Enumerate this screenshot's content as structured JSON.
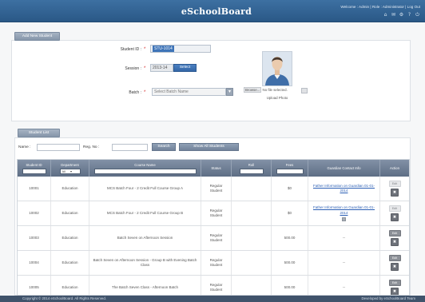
{
  "header": {
    "title": "eSchoolBoard",
    "user_info": "Welcome : Admin  |  Role : Administrator  |  Log Out",
    "icons": [
      "home-icon",
      "mail-icon",
      "settings-icon",
      "help-icon",
      "logout-icon"
    ]
  },
  "colors": {
    "header": "#2e5d8c",
    "tab": "#8e9cb0",
    "button": "#7d8ca2",
    "table_header": "#66778e",
    "link": "#2b5fb5",
    "required": "#d42b2b",
    "selection": "#3e74b8"
  },
  "form": {
    "tab_label": "Add New Student",
    "student_id": {
      "label": "Student ID :",
      "required": "*",
      "value": "STU-1014"
    },
    "session": {
      "label": "Session :",
      "required": "*",
      "value": "2013-14",
      "button_label": "Select"
    },
    "batch": {
      "label": "Batch :",
      "required": "*",
      "value": "Select Batch Name"
    },
    "photo": {
      "file_button": "Browse...",
      "file_status": "No file selected.",
      "caption": "Upload Photo"
    }
  },
  "list": {
    "tab_label": "Student List",
    "filter": {
      "name_label": "Name :",
      "reg_label": "Reg. No :",
      "search_label": "Search",
      "show_all_label": "Show All Students"
    },
    "columns": [
      "Student ID",
      "Department",
      "Course Name",
      "Status",
      "Roll",
      "Fees",
      "Guardian Contact Info",
      "Action"
    ],
    "header_filters": {
      "department": "All"
    },
    "rows": [
      {
        "id": "10001",
        "department": "Education",
        "course": "MCS Batch Four - 2 Credit Full Course Group A",
        "status": "Regular Student",
        "fees": "$0",
        "guardian": "Father Information on Guardian 01-01-2014",
        "action_label": "Edit"
      },
      {
        "id": "10002",
        "department": "Education",
        "course": "MCS Batch Four - 2 Credit Full Course Group B",
        "status": "Regular Student",
        "fees": "$0",
        "guardian": "Father Information on Guardian 01-01-2014",
        "action_label": "Edit"
      },
      {
        "id": "10003",
        "department": "Education",
        "course": "Batch Seven on Afternoon Session",
        "status": "Regular Student",
        "fees": "500.00",
        "guardian": "--",
        "action_label": "Edit"
      },
      {
        "id": "10004",
        "department": "Education",
        "course": "Batch Seven on Afternoon Session - Group B with Evening Batch Class",
        "status": "Regular Student",
        "fees": "500.00",
        "guardian": "--",
        "action_label": "Edit"
      },
      {
        "id": "10005",
        "department": "Education",
        "course": "The Batch Seven Class - Afternoon Batch",
        "status": "Regular Student",
        "fees": "500.00",
        "guardian": "--",
        "action_label": "Edit"
      }
    ]
  },
  "footer": {
    "copyright": "Copyright © 2014 eSchoolBoard. All Rights Reserved.",
    "credit": "Developed by eSchoolBoard Team"
  }
}
